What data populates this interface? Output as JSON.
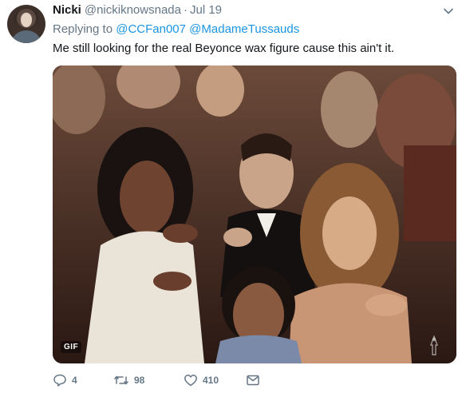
{
  "tweet": {
    "author_name": "Nicki",
    "author_handle": "@nickiknowsnada",
    "separator": "·",
    "date": "Jul 19",
    "replying_to_prefix": "Replying to",
    "reply_mentions": [
      "@CCFan007",
      "@MadameTussauds"
    ],
    "text": "Me still looking for the real Beyonce wax figure cause this ain't it.",
    "media": {
      "badge": "GIF"
    },
    "actions": {
      "reply_count": "4",
      "retweet_count": "98",
      "like_count": "410"
    }
  },
  "icons": {
    "caret": "chevron-down-icon",
    "reply": "reply-icon",
    "retweet": "retweet-icon",
    "like": "heart-icon",
    "dm": "envelope-icon",
    "watermark": "statuette-watermark-icon"
  },
  "colors": {
    "text": "#14171a",
    "secondary": "#657786",
    "link": "#1b95e0"
  }
}
